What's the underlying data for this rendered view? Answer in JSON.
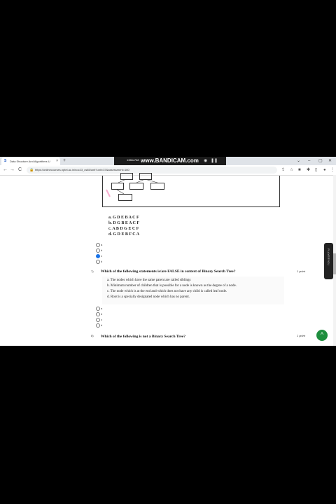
{
  "browser": {
    "tab_title": "Data Structure And Algorithms U",
    "tab_favicon": "S",
    "new_tab_symbol": "+",
    "tab_close": "×",
    "window_controls": [
      "⌄",
      "–",
      "▢",
      "✕"
    ],
    "url": "https://onlinecourses.nptel.ac.in/noc23_cs85/unit?unit=37&assessment=160",
    "recorder_text": "www.BANDICAM.com",
    "recorder_small": "1366x768",
    "nav": {
      "back": "←",
      "forward": "→",
      "reload": "C",
      "home": "⌂"
    }
  },
  "diagram": {
    "nodes": [
      "▢▢",
      "▢▢",
      "▢▢",
      "▢▢",
      "▢▢",
      "▢▢",
      "▢▢"
    ]
  },
  "question_prev": {
    "options": [
      "a.  G D E B A C F",
      "b.  D G B E A C F",
      "c.  A B D G E C F",
      "d.  G D E B F C A"
    ],
    "radio_labels": [
      "a",
      "b",
      "c",
      "d"
    ],
    "selected": "c"
  },
  "question_7": {
    "number": "7)",
    "text": "Which of the following statements is/are FALSE in context of Binary Search Tree?",
    "points": "1 point",
    "statements": [
      "a.  The nodes which have the same parent are called siblings",
      "b.  Minimum number of children that is possible for a node is known as the degree of a node.",
      "c.  The node which is at the end and which does not have any child is called leaf node.",
      "d.  Root  is a specially designated node which has no parent."
    ],
    "radio_labels": [
      "a",
      "b",
      "c",
      "d"
    ]
  },
  "question_8": {
    "number": "8)",
    "text": "Which of the following is not a Binary Search Tree?",
    "points": "1 point"
  },
  "side_tab_label": "PLAYERYOU",
  "fab_icon": "chevron-up-icon",
  "fab_symbol": "^"
}
